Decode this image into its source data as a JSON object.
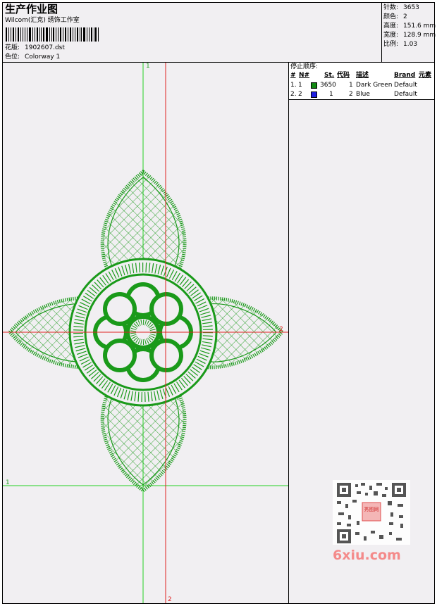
{
  "header": {
    "title": "生产作业图",
    "subtitle": "Wilcom(汇克) 绣饰工作室",
    "design_label": "花版:",
    "design_value": "1902607.dst",
    "colorway_label": "色位:",
    "colorway_value": "Colorway 1"
  },
  "info": {
    "stitches_label": "针数:",
    "stitches_value": "3653",
    "colors_label": "颜色:",
    "colors_value": "2",
    "height_label": "高度:",
    "height_value": "151.6 mm",
    "width_label": "宽度:",
    "width_value": "128.9 mm",
    "ratio_label": "比例:",
    "ratio_value": "1.03"
  },
  "stop_sequence": {
    "title": "停止顺序:",
    "columns": [
      "#",
      "N#",
      "St.",
      "代码",
      "描述",
      "Brand",
      "元素"
    ],
    "rows": [
      {
        "num": "1.",
        "needle": "1",
        "color": "#138a14",
        "stitches": "3650",
        "code": "1",
        "desc": "Dark Green",
        "brand": "Default"
      },
      {
        "num": "2.",
        "needle": "2",
        "color": "#1e1ee0",
        "stitches": "1",
        "code": "2",
        "desc": "Blue",
        "brand": "Default"
      }
    ]
  },
  "canvas": {
    "guide_marks": {
      "v1": "1",
      "h2": "2",
      "h1": "1",
      "v2": "2"
    },
    "design_color": "#1a9a1a",
    "guide_green": "#22d022",
    "guide_red": "#e02020"
  },
  "watermark": {
    "text": "6xiu.com",
    "stamp": "秀图网"
  }
}
